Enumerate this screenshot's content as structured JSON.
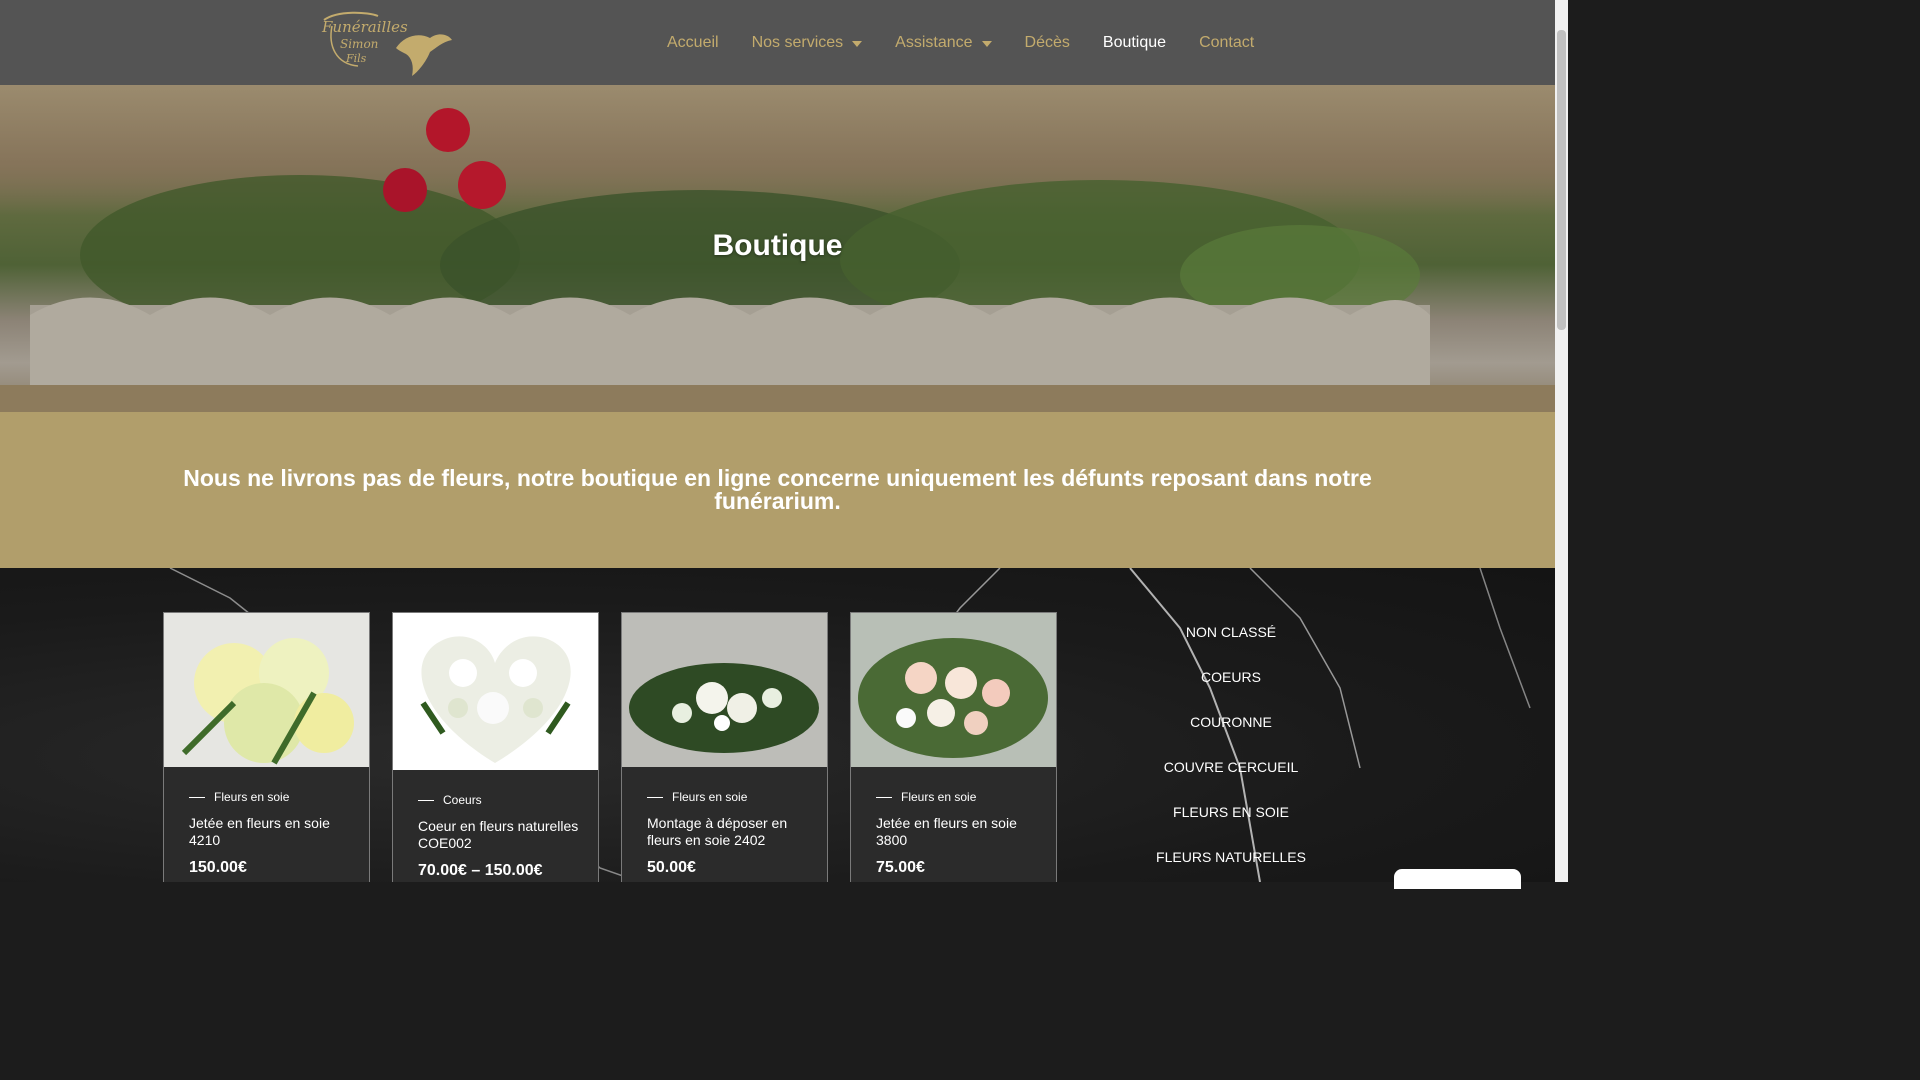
{
  "header": {
    "logo_alt": "Funérailles Simon Fils",
    "nav": [
      {
        "label": "Accueil",
        "dropdown": false,
        "active": false
      },
      {
        "label": "Nos services",
        "dropdown": true,
        "active": false
      },
      {
        "label": "Assistance",
        "dropdown": true,
        "active": false
      },
      {
        "label": "Décès",
        "dropdown": false,
        "active": false
      },
      {
        "label": "Boutique",
        "dropdown": false,
        "active": true
      },
      {
        "label": "Contact",
        "dropdown": false,
        "active": false
      }
    ]
  },
  "hero": {
    "title": "Boutique"
  },
  "notice": {
    "text": "Nous ne livrons pas de fleurs, notre boutique en ligne concerne uniquement les défunts reposant dans notre funérarium."
  },
  "products": [
    {
      "category": "Fleurs en soie",
      "name": "Jetée en fleurs en soie 4210",
      "price": "150.00€"
    },
    {
      "category": "Coeurs",
      "name": "Coeur en fleurs naturelles COE002",
      "price": "70.00€ – 150.00€"
    },
    {
      "category": "Fleurs en soie",
      "name": "Montage à déposer en fleurs en soie 2402",
      "price": "50.00€"
    },
    {
      "category": "Fleurs en soie",
      "name": "Jetée en fleurs en soie 3800",
      "price": "75.00€"
    }
  ],
  "categories": [
    "NON CLASSÉ",
    "COEURS",
    "COURONNE",
    "COUVRE CERCUEIL",
    "FLEURS EN SOIE",
    "FLEURS NATURELLES"
  ],
  "colors": {
    "header_bg": "#545454",
    "gold": "#c3ab6d",
    "band": "#b19e6b",
    "dark": "#1c1c1c"
  }
}
